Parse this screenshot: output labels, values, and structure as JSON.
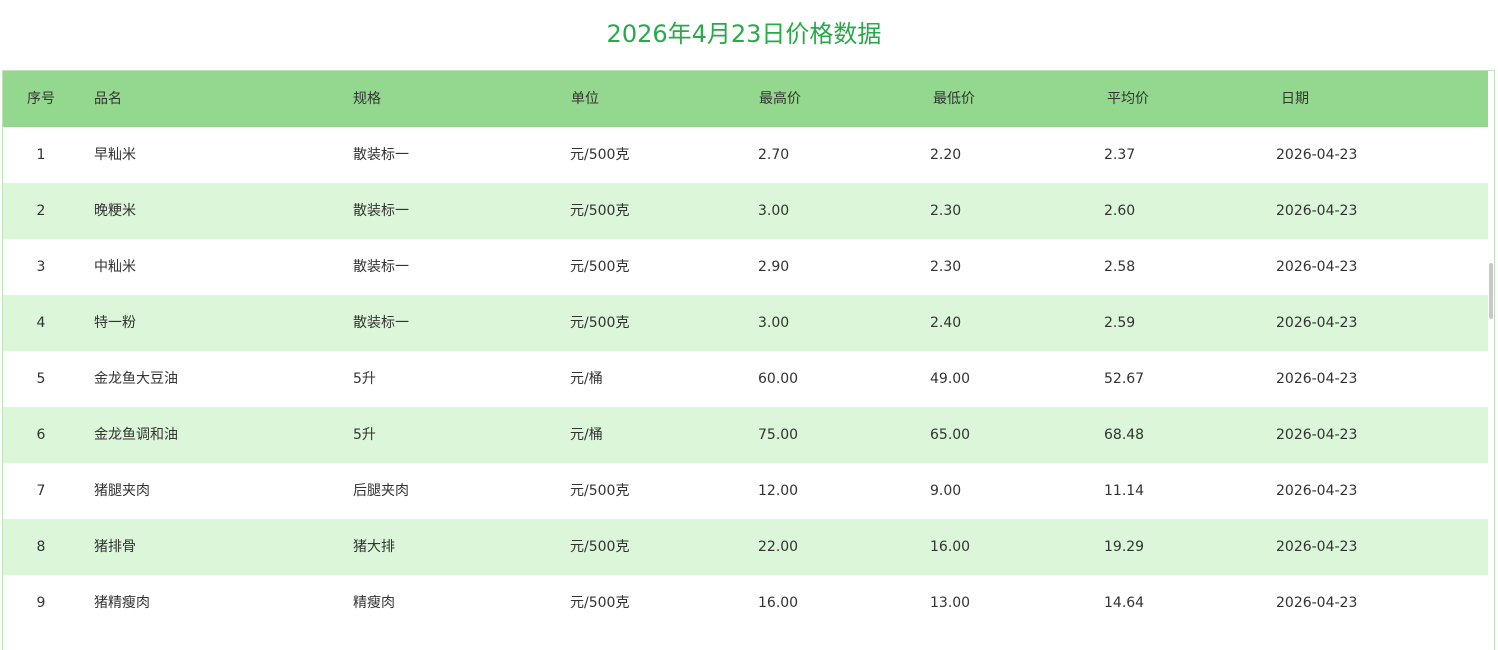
{
  "title": "2026年4月23日价格数据",
  "table": {
    "headers": {
      "no": "序号",
      "name": "品名",
      "spec": "规格",
      "unit": "单位",
      "max": "最高价",
      "min": "最低价",
      "avg": "平均价",
      "date": "日期"
    },
    "rows": [
      {
        "no": "1",
        "name": "早籼米",
        "spec": "散装标一",
        "unit": "元/500克",
        "max": "2.70",
        "min": "2.20",
        "avg": "2.37",
        "date": "2026-04-23"
      },
      {
        "no": "2",
        "name": "晚粳米",
        "spec": "散装标一",
        "unit": "元/500克",
        "max": "3.00",
        "min": "2.30",
        "avg": "2.60",
        "date": "2026-04-23"
      },
      {
        "no": "3",
        "name": "中籼米",
        "spec": "散装标一",
        "unit": "元/500克",
        "max": "2.90",
        "min": "2.30",
        "avg": "2.58",
        "date": "2026-04-23"
      },
      {
        "no": "4",
        "name": "特一粉",
        "spec": "散装标一",
        "unit": "元/500克",
        "max": "3.00",
        "min": "2.40",
        "avg": "2.59",
        "date": "2026-04-23"
      },
      {
        "no": "5",
        "name": "金龙鱼大豆油",
        "spec": "5升",
        "unit": "元/桶",
        "max": "60.00",
        "min": "49.00",
        "avg": "52.67",
        "date": "2026-04-23"
      },
      {
        "no": "6",
        "name": "金龙鱼调和油",
        "spec": "5升",
        "unit": "元/桶",
        "max": "75.00",
        "min": "65.00",
        "avg": "68.48",
        "date": "2026-04-23"
      },
      {
        "no": "7",
        "name": "猪腿夹肉",
        "spec": "后腿夹肉",
        "unit": "元/500克",
        "max": "12.00",
        "min": "9.00",
        "avg": "11.14",
        "date": "2026-04-23"
      },
      {
        "no": "8",
        "name": "猪排骨",
        "spec": "猪大排",
        "unit": "元/500克",
        "max": "22.00",
        "min": "16.00",
        "avg": "19.29",
        "date": "2026-04-23"
      },
      {
        "no": "9",
        "name": "猪精瘦肉",
        "spec": "精瘦肉",
        "unit": "元/500克",
        "max": "16.00",
        "min": "13.00",
        "avg": "14.64",
        "date": "2026-04-23"
      }
    ]
  },
  "colors": {
    "title": "#2aa84a",
    "header_bg": "#94d88f",
    "stripe_bg": "#dbf6d9"
  }
}
